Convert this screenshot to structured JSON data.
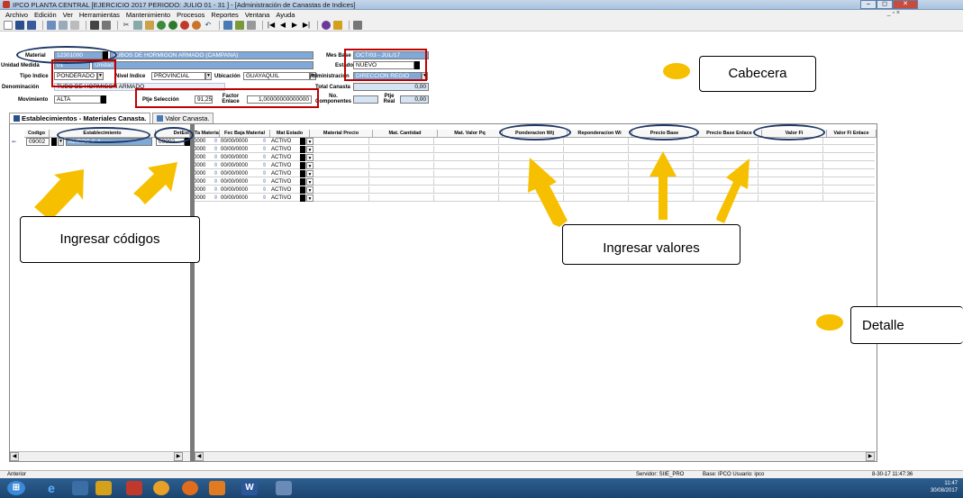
{
  "window": {
    "title": "IPCO PLANTA CENTRAL [EJERCICIO 2017 PERIODO: JULIO 01 - 31 ] - [Administración de Canastas de Indices]",
    "btn_min": "–",
    "btn_max": "◻",
    "btn_close": "✕"
  },
  "menu": {
    "items": [
      "Archivo",
      "Edición",
      "Ver",
      "Herramientas",
      "Mantenimiento",
      "Procesos",
      "Reportes",
      "Ventana",
      "Ayuda"
    ],
    "mdi_controls": "_ ▫ ×"
  },
  "header": {
    "material_label": "Material",
    "material_code": "12301000",
    "material_desc": "TUBOS DE HORMIGON ARMADO (CAMPANA)",
    "unidad_label": "Unidad Medida",
    "unidad_code": "01",
    "unidad_desc": "Unidad",
    "tipo_label": "Tipo Indice",
    "tipo_value": "PONDERADO",
    "nivel_label": "Nivel Indice",
    "nivel_value": "PROVINCIAL",
    "ubicacion_label": "Ubicación",
    "ubicacion_value": "GUAYAQUIL",
    "denom_label": "Denominación",
    "denom_value": "TUBO DE HORMIGON ARMADO",
    "movimiento_label": "Movimiento",
    "movimiento_value": "ALTA",
    "ptje_sel_label": "Ptje Selección",
    "ptje_sel_value": "91,25",
    "factor_label": "Factor Enlace",
    "factor_value": "1,00000000000000",
    "mes_base_label": "Mes Base",
    "mes_base_value": "OCT/03 - JUL/17",
    "estado_label": "Estado",
    "estado_value": "NUEVO",
    "admin_label": "Administración",
    "admin_value": "DIRECCION REGIO",
    "total_label": "Total Canasta",
    "total_value": "0,00",
    "no_comp_label": "No. Componentes",
    "ptje_real_label": "Ptje Real",
    "ptje_real_value": "0,00"
  },
  "tabs": [
    {
      "label": "Establecimientos - Materiales Canasta."
    },
    {
      "label": "Valor Canasta."
    }
  ],
  "grid": {
    "left_headers": [
      "Codigo",
      "Establecimiento",
      "DetEst"
    ],
    "right_headers": [
      "Ta Material",
      "Fec Baja Material",
      "Mat Estado",
      "Material Precio",
      "Mat. Cantidad",
      "Mat. Valor Pq",
      "Ponderacion Wij",
      "Reponderacion Wi",
      "Precio Base",
      "Precio Base Enlace",
      "Valor Fi",
      "Valor Fi Enlace"
    ],
    "first_row": {
      "codigo": "09002",
      "establecimiento": "ALIBOC S.A.",
      "detest": "09002"
    },
    "row_code": "0000",
    "row_date": "00/00/0000",
    "row_estado": "ACTIVO",
    "rows": 8
  },
  "annotations": {
    "cabecera": "Cabecera",
    "detalle": "Detalle",
    "ingresar_codigos": "Ingresar códigos",
    "ingresar_valores": "Ingresar valores",
    "highlight_color": "#c00000",
    "oval_color": "#1f3864",
    "arrow_color": "#f6c000"
  },
  "status": {
    "left": "Anterior",
    "servidor": "Servidor: SIIE_PRO",
    "base": "Base: IPCO Usuario: ipco",
    "datetime": "8-30-17 11:47:36"
  },
  "taskbar": {
    "time": "11:47",
    "date": "30/08/2017"
  }
}
